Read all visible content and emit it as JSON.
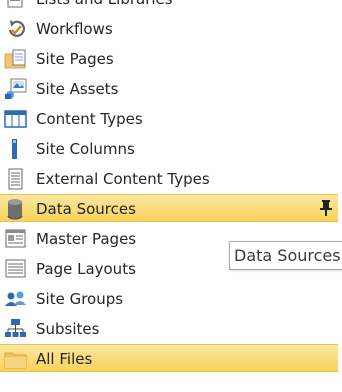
{
  "nav": {
    "items": [
      {
        "label": "Lists and Libraries",
        "icon": "lists-libraries-icon"
      },
      {
        "label": "Workflows",
        "icon": "workflow-icon"
      },
      {
        "label": "Site Pages",
        "icon": "site-pages-icon"
      },
      {
        "label": "Site Assets",
        "icon": "site-assets-icon"
      },
      {
        "label": "Content Types",
        "icon": "content-types-icon"
      },
      {
        "label": "Site Columns",
        "icon": "site-columns-icon"
      },
      {
        "label": "External Content Types",
        "icon": "external-content-types-icon"
      },
      {
        "label": "Data Sources",
        "icon": "database-icon",
        "selected": true,
        "pinned": true
      },
      {
        "label": "Master Pages",
        "icon": "master-pages-icon"
      },
      {
        "label": "Page Layouts",
        "icon": "page-layouts-icon"
      },
      {
        "label": "Site Groups",
        "icon": "site-groups-icon"
      },
      {
        "label": "Subsites",
        "icon": "subsites-icon"
      },
      {
        "label": "All Files",
        "icon": "folder-icon",
        "selected": true
      }
    ]
  },
  "tooltip": {
    "text": "Data Sources"
  },
  "colors": {
    "selected_background": "#f8d86e",
    "text": "#262626",
    "icon_blue": "#2e6ab1"
  }
}
